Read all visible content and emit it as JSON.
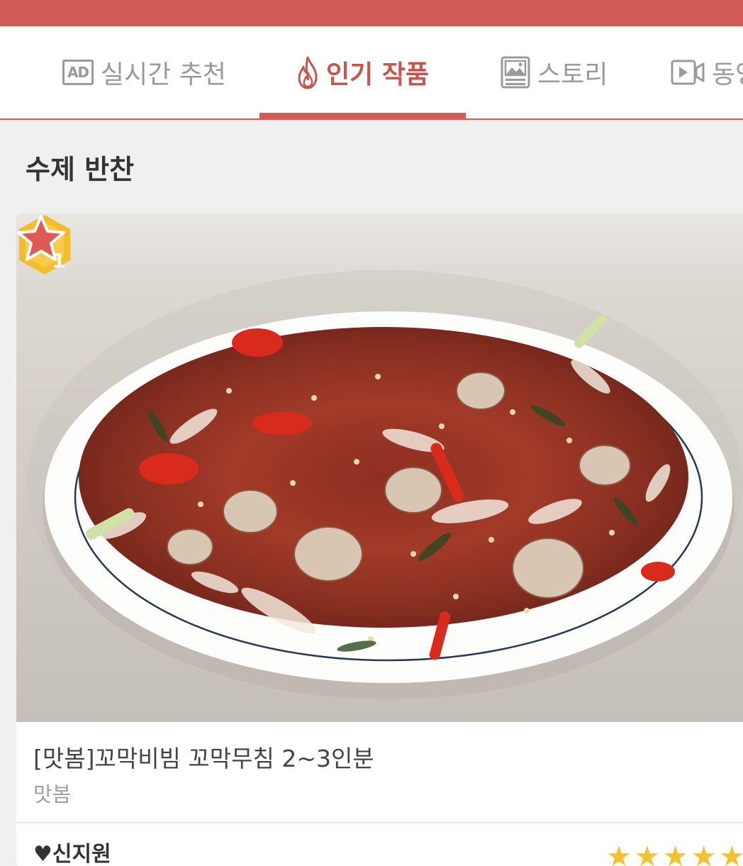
{
  "colors": {
    "accent": "#d15c55",
    "badge": "#f5bd2e",
    "rating": "#f4c22f"
  },
  "tabs": [
    {
      "icon": "ad-icon",
      "ad_text": "AD",
      "label": "실시간 추천",
      "active": false
    },
    {
      "icon": "flame-icon",
      "label": "인기 작품",
      "active": true
    },
    {
      "icon": "image-icon",
      "label": "스토리",
      "active": false
    },
    {
      "icon": "video-icon",
      "label": "동영",
      "active": false
    }
  ],
  "section": {
    "title": "수제 반찬"
  },
  "card": {
    "rank": "1",
    "favorite_icon": "star-icon",
    "title": "[맛봄]꼬막비빔 꼬막무침 2~3인분",
    "seller": "맛봄",
    "reviewer": "♥신지원",
    "rating": 5,
    "rating_text": "★★★★★"
  }
}
